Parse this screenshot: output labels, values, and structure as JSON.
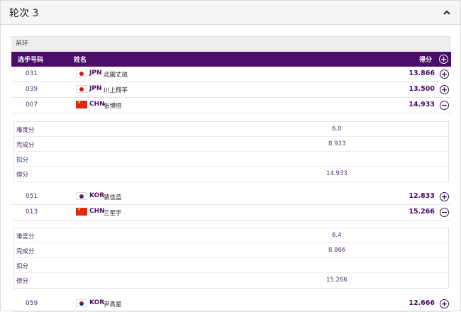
{
  "panel": {
    "title": "轮次 3"
  },
  "apparatus": "吊环",
  "columns": {
    "bib": "选手号码",
    "name": "姓名",
    "score": "得分"
  },
  "detail_labels": {
    "difficulty": "难度分",
    "execution": "完成分",
    "penalty": "扣分",
    "total": "得分"
  },
  "athletes": [
    {
      "bib": "031",
      "noc": "JPN",
      "name": "北園丈琉",
      "score": "13.866",
      "expanded": false
    },
    {
      "bib": "039",
      "noc": "JPN",
      "name": "川上翔平",
      "score": "13.500",
      "expanded": false
    },
    {
      "bib": "007",
      "noc": "CHN",
      "name": "张博恒",
      "score": "14.933",
      "expanded": true,
      "detail": {
        "difficulty": "6.0",
        "execution": "8.933",
        "penalty": "",
        "total": "14.933"
      }
    },
    {
      "bib": "051",
      "noc": "KOR",
      "name": "裴佳蓝",
      "score": "12.833",
      "expanded": false
    },
    {
      "bib": "013",
      "noc": "CHN",
      "name": "兰星宇",
      "score": "15.266",
      "expanded": true,
      "detail": {
        "difficulty": "6.4",
        "execution": "8.866",
        "penalty": "",
        "total": "15.266"
      }
    },
    {
      "bib": "059",
      "noc": "KOR",
      "name": "尹真星",
      "score": "12.666",
      "expanded": false
    }
  ],
  "colors": {
    "header_bg": "#4a0d68",
    "accent": "#3a0a55"
  },
  "icons": {
    "collapse": "chevron-up-icon",
    "expand": "plus-circle-icon",
    "collapse_row": "minus-circle-icon"
  }
}
